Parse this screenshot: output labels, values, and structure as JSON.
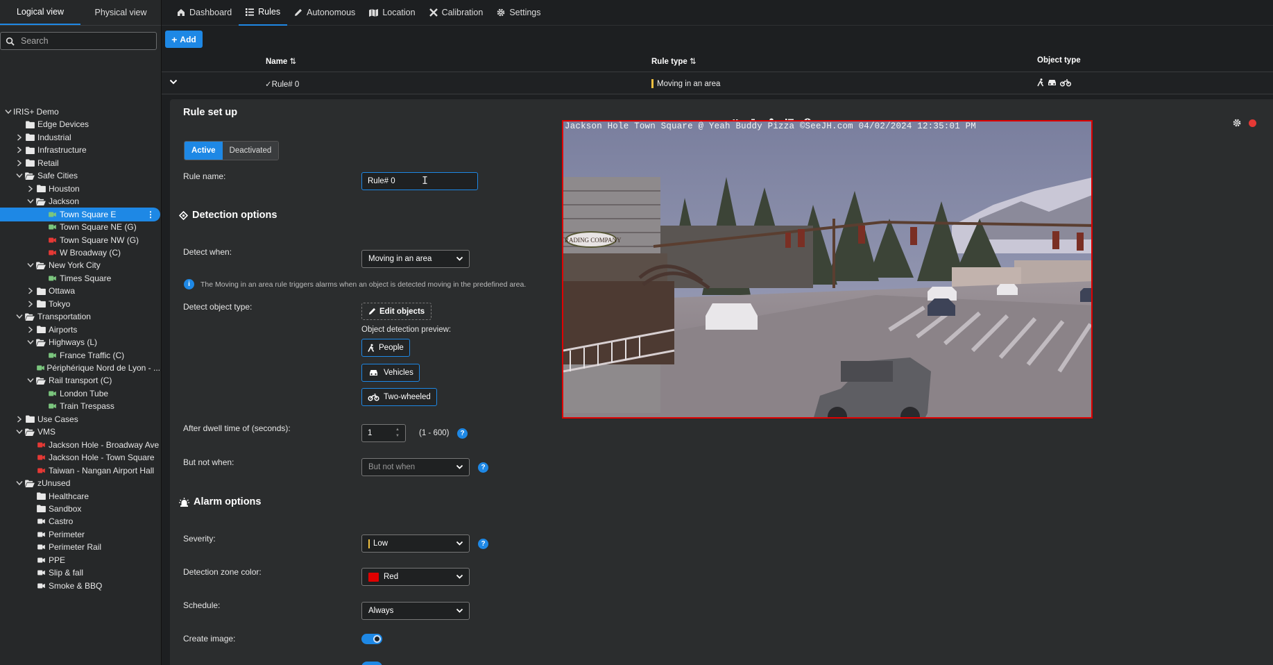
{
  "sidebar": {
    "tabs": [
      "Logical view",
      "Physical view"
    ],
    "search_placeholder": "Search",
    "tree": [
      {
        "label": "IRIS+ Demo",
        "depth": 0,
        "expander": "open",
        "icon": "none"
      },
      {
        "label": "Edge Devices",
        "depth": 1,
        "expander": "none",
        "icon": "folder"
      },
      {
        "label": "Industrial",
        "depth": 1,
        "expander": "closed",
        "icon": "folder"
      },
      {
        "label": "Infrastructure",
        "depth": 1,
        "expander": "closed",
        "icon": "folder"
      },
      {
        "label": "Retail",
        "depth": 1,
        "expander": "closed",
        "icon": "folder"
      },
      {
        "label": "Safe Cities",
        "depth": 1,
        "expander": "open",
        "icon": "folder-open"
      },
      {
        "label": "Houston",
        "depth": 2,
        "expander": "closed",
        "icon": "folder"
      },
      {
        "label": "Jackson",
        "depth": 2,
        "expander": "open",
        "icon": "folder-open"
      },
      {
        "label": "Town Square E",
        "depth": 3,
        "expander": "none",
        "icon": "camera-green",
        "selected": true
      },
      {
        "label": "Town Square NE (G)",
        "depth": 3,
        "expander": "none",
        "icon": "camera-green"
      },
      {
        "label": "Town Square NW (G)",
        "depth": 3,
        "expander": "none",
        "icon": "camera-red"
      },
      {
        "label": "W Broadway (C)",
        "depth": 3,
        "expander": "none",
        "icon": "camera-red"
      },
      {
        "label": "New York City",
        "depth": 2,
        "expander": "open",
        "icon": "folder-open"
      },
      {
        "label": "Times Square",
        "depth": 3,
        "expander": "none",
        "icon": "camera-green"
      },
      {
        "label": "Ottawa",
        "depth": 2,
        "expander": "closed",
        "icon": "folder"
      },
      {
        "label": "Tokyo",
        "depth": 2,
        "expander": "closed",
        "icon": "folder"
      },
      {
        "label": "Transportation",
        "depth": 1,
        "expander": "open",
        "icon": "folder-open"
      },
      {
        "label": "Airports",
        "depth": 2,
        "expander": "closed",
        "icon": "folder"
      },
      {
        "label": "Highways (L)",
        "depth": 2,
        "expander": "open",
        "icon": "folder-open"
      },
      {
        "label": "France Traffic (C)",
        "depth": 3,
        "expander": "none",
        "icon": "camera-green"
      },
      {
        "label": "Périphérique Nord de Lyon - ...",
        "depth": 3,
        "expander": "none",
        "icon": "camera-green"
      },
      {
        "label": "Rail transport (C)",
        "depth": 2,
        "expander": "open",
        "icon": "folder-open"
      },
      {
        "label": "London Tube",
        "depth": 3,
        "expander": "none",
        "icon": "camera-green"
      },
      {
        "label": "Train Trespass",
        "depth": 3,
        "expander": "none",
        "icon": "camera-green"
      },
      {
        "label": "Use Cases",
        "depth": 1,
        "expander": "closed",
        "icon": "folder"
      },
      {
        "label": "VMS",
        "depth": 1,
        "expander": "open",
        "icon": "folder-open"
      },
      {
        "label": "Jackson Hole - Broadway Ave",
        "depth": 2,
        "expander": "none",
        "icon": "camera-red"
      },
      {
        "label": "Jackson Hole - Town Square",
        "depth": 2,
        "expander": "none",
        "icon": "camera-red"
      },
      {
        "label": "Taiwan - Nangan Airport Hall",
        "depth": 2,
        "expander": "none",
        "icon": "camera-red"
      },
      {
        "label": "zUnused",
        "depth": 1,
        "expander": "open",
        "icon": "folder-open"
      },
      {
        "label": "Healthcare",
        "depth": 2,
        "expander": "none",
        "icon": "folder"
      },
      {
        "label": "Sandbox",
        "depth": 2,
        "expander": "none",
        "icon": "folder"
      },
      {
        "label": "Castro",
        "depth": 2,
        "expander": "none",
        "icon": "camera-white"
      },
      {
        "label": "Perimeter",
        "depth": 2,
        "expander": "none",
        "icon": "camera-white"
      },
      {
        "label": "Perimeter Rail",
        "depth": 2,
        "expander": "none",
        "icon": "camera-white"
      },
      {
        "label": "PPE",
        "depth": 2,
        "expander": "none",
        "icon": "camera-white"
      },
      {
        "label": "Slip & fall",
        "depth": 2,
        "expander": "none",
        "icon": "camera-white"
      },
      {
        "label": "Smoke & BBQ",
        "depth": 2,
        "expander": "none",
        "icon": "camera-white"
      }
    ]
  },
  "nav": {
    "dashboard": "Dashboard",
    "rules": "Rules",
    "autonomous": "Autonomous",
    "location": "Location",
    "calibration": "Calibration",
    "settings": "Settings"
  },
  "toolbar": {
    "add_label": "Add"
  },
  "table": {
    "col_name": "Name",
    "col_rule_type": "Rule type",
    "col_object_type": "Object type",
    "row": {
      "name": "Rule# 0",
      "rule_type": "Moving in an area",
      "rule_type_color": "#f0c040"
    }
  },
  "rule": {
    "title": "Rule set up",
    "state_active": "Active",
    "state_deactivated": "Deactivated",
    "name_label": "Rule name:",
    "name_value": "Rule# 0",
    "detection_title": "Detection options",
    "detect_when_label": "Detect when:",
    "detect_when_value": "Moving in an area",
    "info_text": "The Moving in an area rule triggers alarms when an object is detected moving in the predefined area.",
    "object_type_label": "Detect object type:",
    "edit_objects": "Edit objects",
    "preview_label": "Object detection preview:",
    "people": "People",
    "vehicles": "Vehicles",
    "two_wheeled": "Two-wheeled",
    "dwell_label": "After dwell time of (seconds):",
    "dwell_value": "1",
    "dwell_range": "(1 - 600)",
    "but_not_label": "But not when:",
    "but_not_placeholder": "But not when",
    "alarm_title": "Alarm options",
    "severity_label": "Severity:",
    "severity_value": "Low",
    "zone_color_label": "Detection zone color:",
    "zone_color_value": "Red",
    "zone_color_hex": "#e00000",
    "schedule_label": "Schedule:",
    "schedule_value": "Always",
    "create_image_label": "Create image:",
    "help": "?",
    "info_icon": "i"
  },
  "video": {
    "overlay_text": "Jackson Hole Town Square @ Yeah Buddy Pizza ©SeeJH.com 04/02/2024 12:35:01 PM",
    "sign_text": "TRADING COMPANY"
  },
  "colors": {
    "accent": "#1e88e5",
    "zone": "#e00000",
    "severity_low": "#f0c040"
  }
}
